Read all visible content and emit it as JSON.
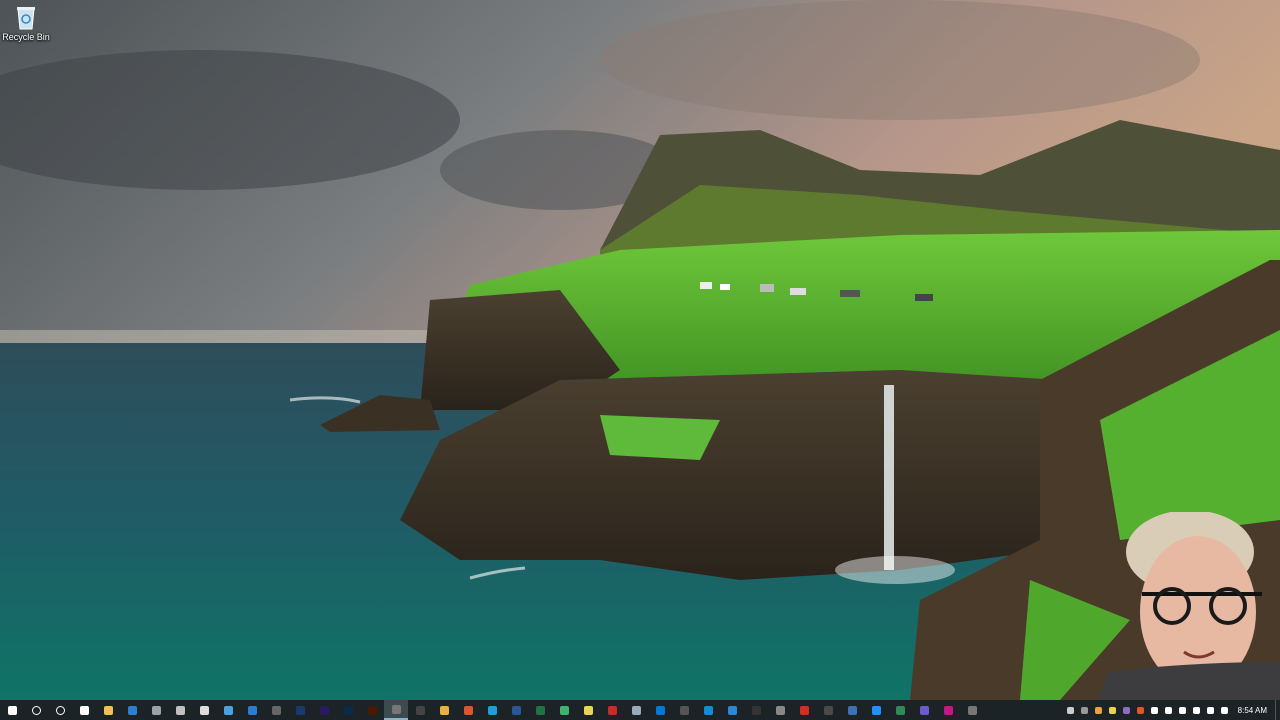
{
  "desktop": {
    "icons": [
      {
        "label": "Recycle Bin",
        "icon": "recycle-bin-icon"
      }
    ]
  },
  "taskbar": {
    "pinned": [
      {
        "icon": "windows-start-icon",
        "color": "#ffffff"
      },
      {
        "icon": "search-icon",
        "color": "#ffffff"
      },
      {
        "icon": "cortana-icon",
        "color": "#ffffff"
      },
      {
        "icon": "task-view-icon",
        "color": "#ffffff"
      },
      {
        "icon": "file-explorer-icon",
        "color": "#f2c14e"
      },
      {
        "icon": "store-icon",
        "color": "#2d7dd2"
      },
      {
        "icon": "app-icon-1",
        "color": "#9aa3a8"
      },
      {
        "icon": "app-icon-2",
        "color": "#c0c0c0"
      },
      {
        "icon": "app-icon-3",
        "color": "#dddddd"
      },
      {
        "icon": "app-icon-4",
        "color": "#4aa3df"
      },
      {
        "icon": "app-icon-5",
        "color": "#2b7cd3"
      },
      {
        "icon": "app-icon-6",
        "color": "#666666"
      },
      {
        "icon": "app-icon-7",
        "color": "#1a3a6b"
      },
      {
        "icon": "premiere-pro-icon",
        "color": "#2a1a5e"
      },
      {
        "icon": "photoshop-icon",
        "color": "#0a2a4a"
      },
      {
        "icon": "illustrator-icon",
        "color": "#4a1a00"
      },
      {
        "icon": "app-icon-8",
        "color": "#777777"
      },
      {
        "icon": "obs-icon",
        "color": "#444444"
      },
      {
        "icon": "chrome-icon",
        "color": "#e9b23a"
      },
      {
        "icon": "brave-icon",
        "color": "#e0552b"
      },
      {
        "icon": "app-icon-9",
        "color": "#18a0d8"
      },
      {
        "icon": "word-icon",
        "color": "#2b579a"
      },
      {
        "icon": "excel-icon",
        "color": "#217346"
      },
      {
        "icon": "app-icon-10",
        "color": "#3cb371"
      },
      {
        "icon": "app-icon-11",
        "color": "#e8d44d"
      },
      {
        "icon": "app-icon-12",
        "color": "#cc2929"
      },
      {
        "icon": "app-icon-13",
        "color": "#9ab"
      },
      {
        "icon": "app-icon-14",
        "color": "#0078d7"
      },
      {
        "icon": "app-icon-15",
        "color": "#555555"
      },
      {
        "icon": "app-icon-16",
        "color": "#0b8fd8"
      },
      {
        "icon": "app-icon-17",
        "color": "#2b88d8"
      },
      {
        "icon": "app-icon-18",
        "color": "#333333"
      },
      {
        "icon": "app-icon-19",
        "color": "#888888"
      },
      {
        "icon": "app-icon-20",
        "color": "#d62d20"
      },
      {
        "icon": "app-icon-21",
        "color": "#4a4a4a"
      },
      {
        "icon": "app-icon-22",
        "color": "#3f6fb5"
      },
      {
        "icon": "app-icon-23",
        "color": "#1e90ff"
      },
      {
        "icon": "app-icon-24",
        "color": "#2e8b57"
      },
      {
        "icon": "app-icon-25",
        "color": "#6a5acd"
      },
      {
        "icon": "app-icon-26",
        "color": "#c71585"
      },
      {
        "icon": "app-icon-27",
        "color": "#777777"
      }
    ],
    "tray": [
      {
        "icon": "tray-app-1",
        "color": "#cccccc"
      },
      {
        "icon": "tray-app-2",
        "color": "#999999"
      },
      {
        "icon": "tray-app-3",
        "color": "#e8a33a"
      },
      {
        "icon": "tray-app-4",
        "color": "#e8d44d"
      },
      {
        "icon": "tray-app-5",
        "color": "#8e6bbf"
      },
      {
        "icon": "tray-app-6",
        "color": "#e0552b"
      },
      {
        "icon": "show-hidden-icons-icon",
        "color": "#ffffff"
      },
      {
        "icon": "cloud-icon",
        "color": "#ffffff"
      },
      {
        "icon": "microphone-icon",
        "color": "#ffffff"
      },
      {
        "icon": "network-icon",
        "color": "#ffffff"
      },
      {
        "icon": "volume-icon",
        "color": "#ffffff"
      },
      {
        "icon": "display-icon",
        "color": "#ffffff"
      }
    ],
    "clock": "8:54 AM"
  }
}
